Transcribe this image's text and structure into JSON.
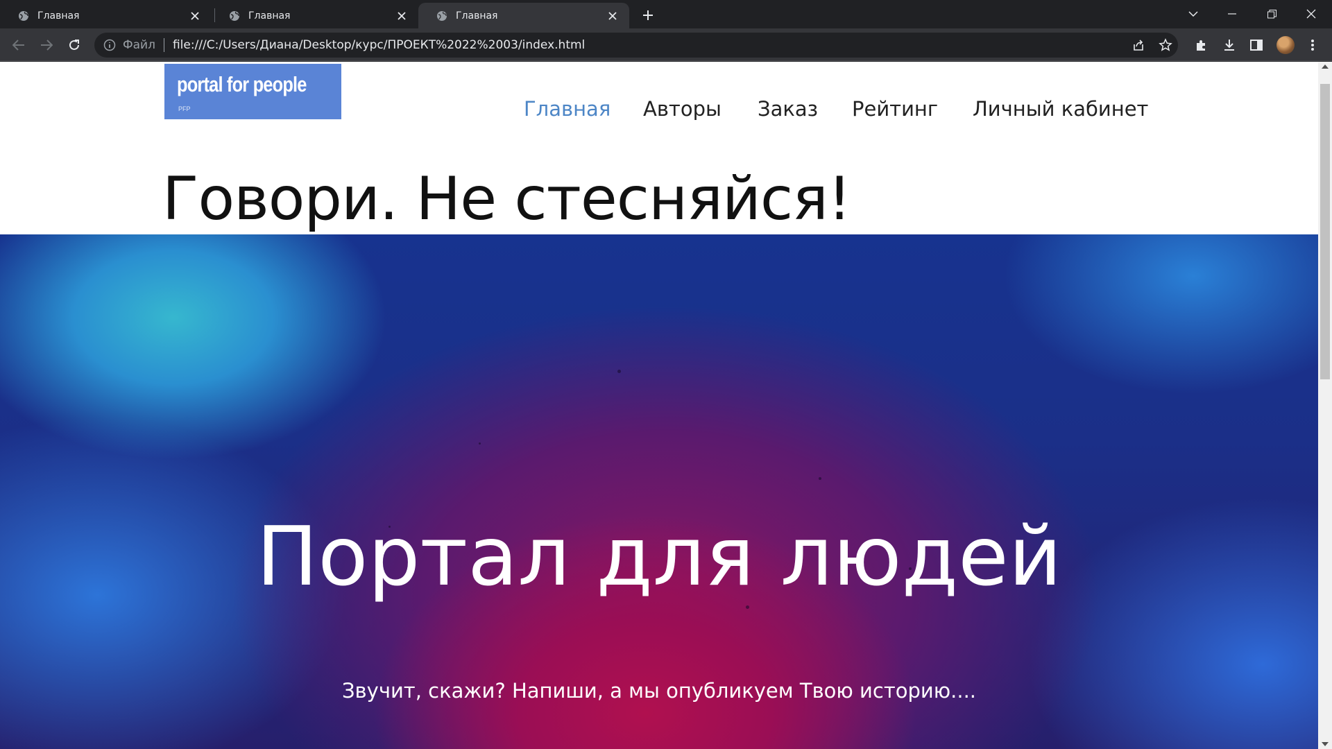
{
  "browser": {
    "tabs": [
      {
        "title": "Главная",
        "active": false
      },
      {
        "title": "Главная",
        "active": false
      },
      {
        "title": "Главная",
        "active": true
      }
    ],
    "address": {
      "scheme_label": "Файл",
      "url": "file:///C:/Users/Диана/Desktop/курс/ПРОЕКТ%2022%2003/index.html"
    }
  },
  "page": {
    "logo": {
      "text": "portal for people",
      "subtext": "PFP"
    },
    "nav": [
      {
        "label": "Главная",
        "active": true
      },
      {
        "label": "Авторы",
        "active": false
      },
      {
        "label": "Заказ",
        "active": false
      },
      {
        "label": "Рейтинг",
        "active": false
      },
      {
        "label": "Личный кабинет",
        "active": false
      }
    ],
    "tagline": "Говори. Не стесняйся!",
    "hero": {
      "title": "Портал для людей",
      "subtitle": "Звучит, скажи? Напиши, а мы опубликуем Твою историю...."
    }
  },
  "colors": {
    "nav_active": "#4d86c6",
    "logo_bg": "#5a84d6",
    "browser_frame": "#202124",
    "toolbar": "#35363a"
  },
  "icons": [
    "globe-icon",
    "close-icon",
    "plus-icon",
    "chevron-down-icon",
    "minimize-icon",
    "restore-icon",
    "back-icon",
    "forward-icon",
    "reload-icon",
    "info-icon",
    "share-icon",
    "star-icon",
    "extensions-icon",
    "download-icon",
    "side-panel-icon",
    "more-icon"
  ]
}
